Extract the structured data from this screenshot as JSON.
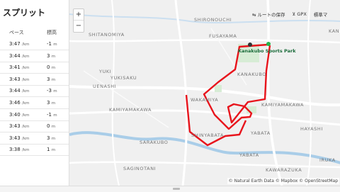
{
  "splits": {
    "title": "スプリット",
    "headers": {
      "pace": "ペース",
      "elevation": "標高"
    },
    "pace_unit": "/km",
    "elev_unit": "m",
    "rows": [
      {
        "pace": "3:47",
        "elev": "-1"
      },
      {
        "pace": "3:44",
        "elev": "3"
      },
      {
        "pace": "3:41",
        "elev": "0"
      },
      {
        "pace": "3:43",
        "elev": "3"
      },
      {
        "pace": "3:44",
        "elev": "-3"
      },
      {
        "pace": "3:46",
        "elev": "3"
      },
      {
        "pace": "3:40",
        "elev": "-1"
      },
      {
        "pace": "3:43",
        "elev": "0"
      },
      {
        "pace": "3:43",
        "elev": "3"
      },
      {
        "pace": "3:38",
        "elev": "1"
      }
    ]
  },
  "map": {
    "zoom_in": "+",
    "zoom_out": "−",
    "save_route": "ルートの保存",
    "gpx": "GPX",
    "map_type": "標準マ",
    "park_name": "Kanakubo Sports Park",
    "attribution": "© Natural Earth Data © Mapbox © OpenStreetMap",
    "route_color": "#e8141c",
    "labels": {
      "shironouchi": "SHIRONOUCHI",
      "fusayama": "FUSAYAMA",
      "shitanomiya": "SHITANOMIYA",
      "yuki": "YUKI",
      "yukisaku": "YUKISAKU",
      "uenashi": "UENASHI",
      "kanakubo": "KANAKUBO",
      "wakamiya": "WAKAMIYA",
      "kamiyamakawa_w": "KAMIYAMAKAWA",
      "kamiyamakawa_e": "KAMIYAMAKAWA",
      "hayashi": "HAYASHI",
      "shinyabata": "SHINYABATA",
      "yabata_n": "YABATA",
      "yabata_s": "YABATA",
      "sarakubo": "SARAKUBO",
      "saginotani": "SAGINOTANI",
      "kawarazuka": "KAWARAZUKA",
      "kan": "KAN",
      "iruka": "IRUKA"
    }
  }
}
